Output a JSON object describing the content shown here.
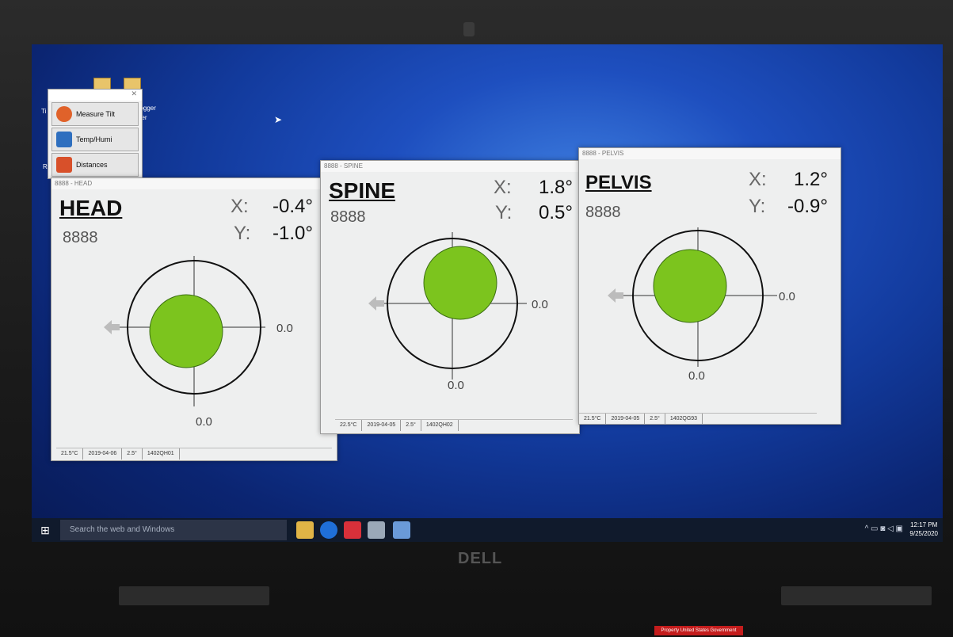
{
  "desktop": {
    "icon_labels": [
      "Logger",
      "der",
      "Rec",
      "Ti"
    ]
  },
  "launcher": {
    "items": [
      {
        "label": "Measure Tilt",
        "icon": "measure-tilt-icon",
        "color": "#e0622a"
      },
      {
        "label": "Temp/Humi",
        "icon": "temp-humi-icon",
        "color": "#2f6fbf"
      },
      {
        "label": "Distances",
        "icon": "distances-icon",
        "color": "#d8502a"
      }
    ]
  },
  "windows": [
    {
      "titlebar": "8888 - HEAD",
      "name": "HEAD",
      "id": "8888",
      "x_label": "X:",
      "x_value": "-0.4°",
      "y_label": "Y:",
      "y_value": "-1.0°",
      "right_readout": "0.0",
      "bottom_readout": "0.0",
      "status": [
        "21.5°C",
        "2019-04-06",
        "2.5°",
        "1402QH01"
      ]
    },
    {
      "titlebar": "8888 - SPINE",
      "name": "SPINE",
      "id": "8888",
      "x_label": "X:",
      "x_value": "1.8°",
      "y_label": "Y:",
      "y_value": "0.5°",
      "right_readout": "0.0",
      "bottom_readout": "0.0",
      "status": [
        "22.5°C",
        "2019-04-05",
        "2.5°",
        "1402QH02"
      ]
    },
    {
      "titlebar": "8888 - PELVIS",
      "name": "PELVIS",
      "id": "8888",
      "x_label": "X:",
      "x_value": "1.2°",
      "y_label": "Y:",
      "y_value": "-0.9°",
      "right_readout": "0.0",
      "bottom_readout": "0.0",
      "status": [
        "21.5°C",
        "2019-04-05",
        "2.5°",
        "1402QG93"
      ]
    }
  ],
  "taskbar": {
    "search_placeholder": "Search the web and Windows",
    "clock_time": "12:17 PM",
    "clock_date": "9/25/2020"
  },
  "brand": "DELL",
  "sticker": "Property United States Government",
  "colors": {
    "bubble": "#7cc41e",
    "accent": "#1e4fbf"
  }
}
